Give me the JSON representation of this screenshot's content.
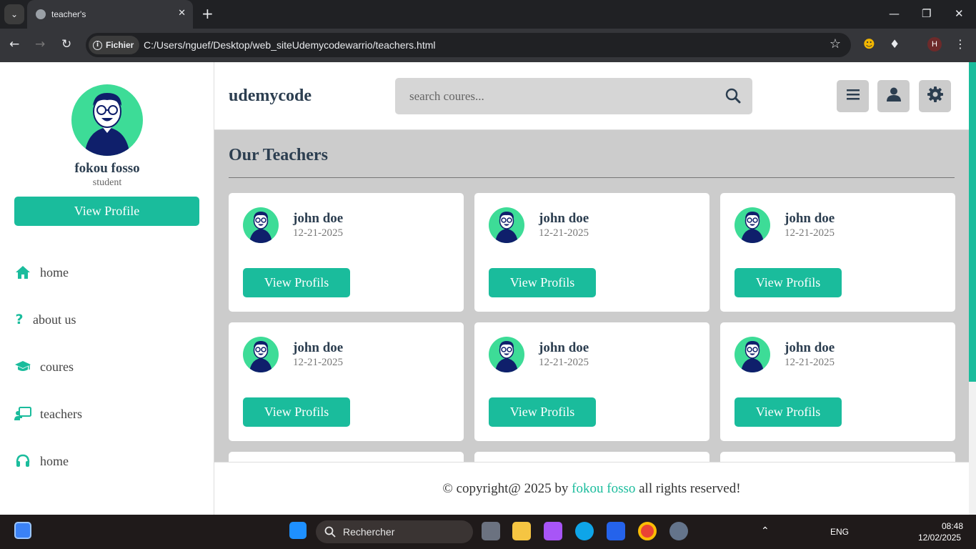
{
  "browser": {
    "tab_title": "teacher's",
    "site_info_label": "Fichier",
    "url": "C:/Users/nguef/Desktop/web_siteUdemycodewarrio/teachers.html",
    "profile_initial": "H"
  },
  "sidebar": {
    "user_name": "fokou fosso",
    "user_role": "student",
    "view_profile_label": "View Profile",
    "nav": [
      {
        "label": "home",
        "icon": "house-icon"
      },
      {
        "label": "about us",
        "icon": "question-icon"
      },
      {
        "label": "coures",
        "icon": "graduation-cap-icon"
      },
      {
        "label": "teachers",
        "icon": "chalkboard-teacher-icon"
      },
      {
        "label": "home",
        "icon": "headset-icon"
      }
    ]
  },
  "header": {
    "logo": "udemycode",
    "search_placeholder": "search coures...",
    "buttons": [
      "menu-icon",
      "user-icon",
      "gear-icon"
    ]
  },
  "main": {
    "heading": "Our Teachers",
    "teachers": [
      {
        "name": "john doe",
        "date": "12-21-2025",
        "button": "View Profils"
      },
      {
        "name": "john doe",
        "date": "12-21-2025",
        "button": "View Profils"
      },
      {
        "name": "john doe",
        "date": "12-21-2025",
        "button": "View Profils"
      },
      {
        "name": "john doe",
        "date": "12-21-2025",
        "button": "View Profils"
      },
      {
        "name": "john doe",
        "date": "12-21-2025",
        "button": "View Profils"
      },
      {
        "name": "john doe",
        "date": "12-21-2025",
        "button": "View Profils"
      }
    ]
  },
  "footer": {
    "prefix": "© copyright@ 2025 by",
    "author": "fokou fosso",
    "suffix": "all rights reserved!"
  },
  "taskbar": {
    "search_label": "Rechercher",
    "language": "ENG",
    "time": "08:48",
    "date": "12/02/2025"
  },
  "colors": {
    "accent": "#1abc9c",
    "avatar_bg": "#3ddc97",
    "text_dark": "#2c3e50",
    "main_bg": "#cccccc"
  }
}
